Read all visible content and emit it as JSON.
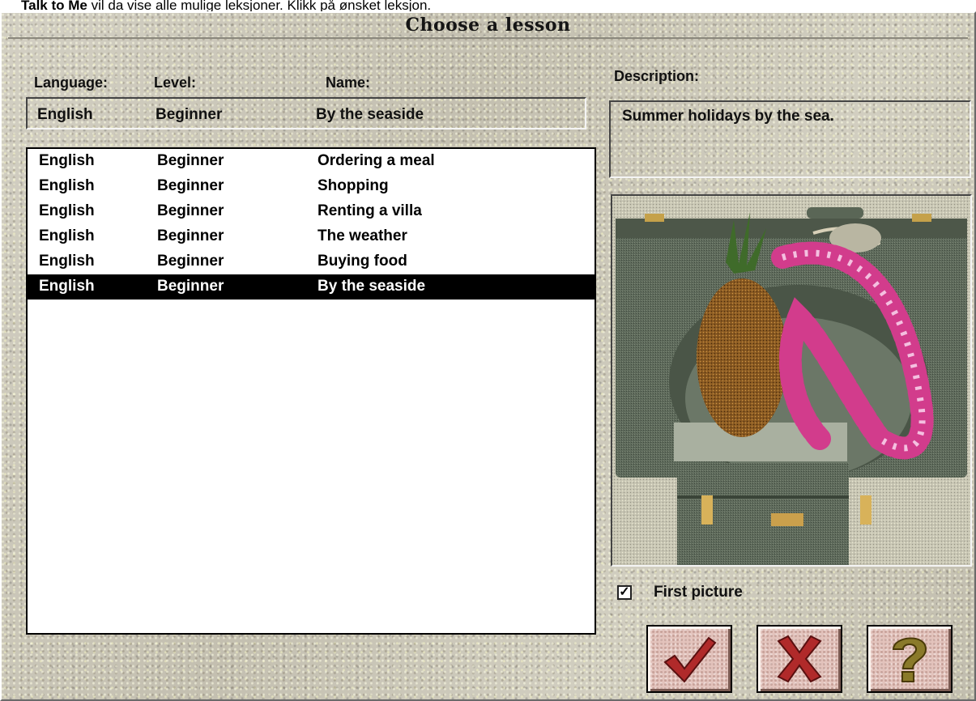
{
  "caption": {
    "bold": "Talk to Me",
    "rest": " vil da vise alle mulige leksjoner. Klikk på ønsket leksjon."
  },
  "window": {
    "title": "Choose a lesson"
  },
  "headers": {
    "language": "Language:",
    "level": "Level:",
    "name": "Name:",
    "description": "Description:"
  },
  "selected": {
    "language": "English",
    "level": "Beginner",
    "name": "By the seaside"
  },
  "description": "Summer holidays by the sea.",
  "lessons": [
    {
      "language": "English",
      "level": "Beginner",
      "name": "Ordering a meal"
    },
    {
      "language": "English",
      "level": "Beginner",
      "name": "Shopping"
    },
    {
      "language": "English",
      "level": "Beginner",
      "name": "Renting a villa"
    },
    {
      "language": "English",
      "level": "Beginner",
      "name": "The weather"
    },
    {
      "language": "English",
      "level": "Beginner",
      "name": "Buying food"
    },
    {
      "language": "English",
      "level": "Beginner",
      "name": "By the seaside"
    }
  ],
  "selected_index": 5,
  "picture": {
    "subject": "pineapple-lei-suitcase-picture"
  },
  "first_picture": {
    "label": "First picture",
    "checked": true
  },
  "buttons": {
    "ok_icon": "checkmark-icon",
    "cancel_icon": "x-icon",
    "help_icon": "question-mark-icon"
  },
  "colors": {
    "dialog_bg": "#c9c5b6",
    "selection": "#000000",
    "button_face": "#e3c3bc",
    "icon_red": "#b02a2a",
    "icon_olive": "#8a7a2a"
  }
}
